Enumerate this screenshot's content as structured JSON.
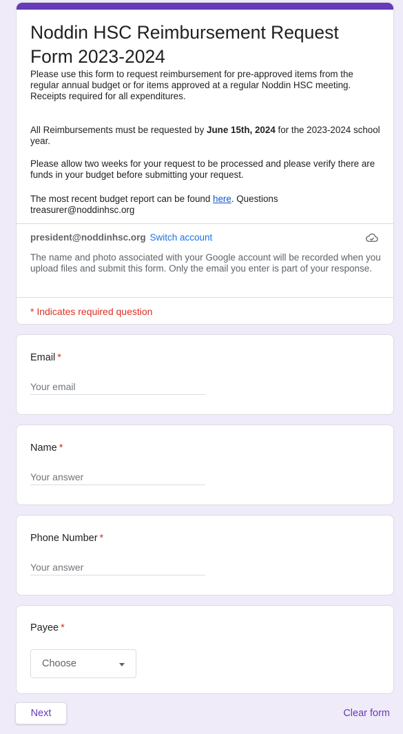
{
  "colors": {
    "accent": "#673ab7",
    "background": "#f0ebf8",
    "required": "#d93025",
    "link": "#1a73e8"
  },
  "header": {
    "title": "Noddin HSC Reimbursement Request Form 2023-2024",
    "description": {
      "p1": "Please use this form to request reimbursement for pre-approved items from the regular annual budget or for items approved at a regular Noddin HSC meeting. Receipts required for all expenditures.",
      "p2_before": "All Reimbursements must be requested by ",
      "p2_bold": "June 15th, 2024",
      "p2_after": " for the 2023-2024 school year.",
      "p3": "Please allow two weeks for your request to be processed and please verify there are funds in your budget before submitting your request.",
      "p4_before": "The most recent budget report can be found ",
      "p4_link": "here",
      "p4_after": ". Questions treasurer@noddinhsc.org"
    },
    "account_email": "president@noddinhsc.org",
    "switch_account": "Switch account",
    "cloud_icon": "cloud-check-icon",
    "notice": "The name and photo associated with your Google account will be recorded when you upload files and submit this form. Only the email you enter is part of your response.",
    "required_note": "* Indicates required question"
  },
  "questions": [
    {
      "label": "Email",
      "star": "*",
      "placeholder": "Your email"
    },
    {
      "label": "Name",
      "star": "*",
      "placeholder": "Your answer"
    },
    {
      "label": "Phone Number",
      "star": "*",
      "placeholder": "Your answer"
    },
    {
      "label": "Payee",
      "star": "*",
      "selected": "Choose"
    }
  ],
  "footer": {
    "next_label": "Next",
    "clear_label": "Clear form"
  }
}
